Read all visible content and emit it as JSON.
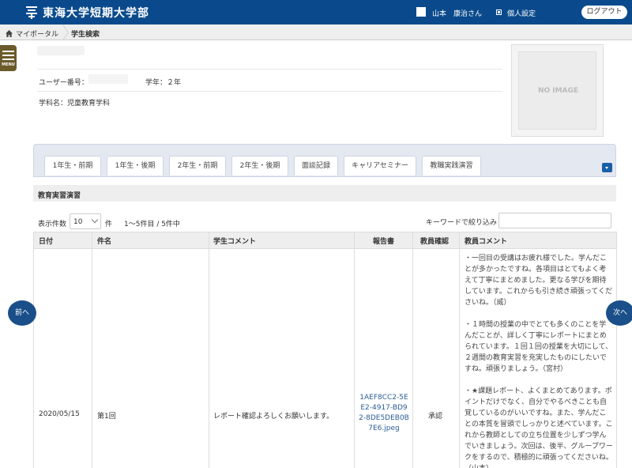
{
  "header": {
    "university": "東海大学短期大学部",
    "user_name": "山本　康治さん",
    "settings_label": "個人設定",
    "logout_label": "ログアウト"
  },
  "breadcrumb": {
    "home": "マイポータル",
    "current": "学生検索"
  },
  "menu_label": "MENU",
  "profile": {
    "user_no_label": "ユーザー番号：",
    "grade_label": "学年：２年",
    "dept_label": "学科名：児童教育学科",
    "no_image": "NO IMAGE"
  },
  "tabs": [
    {
      "label": "1年生・前期"
    },
    {
      "label": "1年生・後期"
    },
    {
      "label": "2年生・前期"
    },
    {
      "label": "2年生・後期"
    },
    {
      "label": "面談記録"
    },
    {
      "label": "キャリアセミナー"
    },
    {
      "label": "教職実践演習"
    }
  ],
  "section_title": "教育実習演習",
  "list": {
    "count_label": "表示件数",
    "count_value": "10",
    "count_unit": "件",
    "range": "1～5件目 / 5件中",
    "keyword_label": "キーワードで絞り込み"
  },
  "table": {
    "headers": [
      "日付",
      "件名",
      "学生コメント",
      "報告書",
      "教員確認",
      "教員コメント"
    ],
    "row": {
      "date": "2020/05/15",
      "subject": "第1回",
      "student_comment": "レポート確認よろしくお願いします。",
      "report": "1AEF8CC2-5EE2-4917-BD92-8DE5DEB0B7E6.jpeg",
      "confirm": "承認",
      "teacher_comments": [
        "・一回目の受講はお疲れ様でした。学んだことが多かったですね。各項目はとてもよく考えて丁寧にまとめました。更なる学びを期待しています。これからも引き続き頑張ってくださいね。（威）",
        "・１時間の授業の中でとても多くのことを学んだことが、詳しく丁寧にレポートにまとめられています。１回１回の授業を大切にして、２週間の教育実習を充実したものにしたいですね。頑張りましょう。（宮村）",
        "・★課題レポート、よくまとめてあります。ポイントだけでなく、自分でやるべきことも自覚しているのがいいですね。また、学んだことの本質を冒頭でしっかりと述べています。これから教師としての立ち位置を少しずつ学んでいきましょう。次回は、後半、グループワークをするので、積極的に頑張ってくださいね。（山本）"
      ]
    }
  },
  "nav": {
    "prev": "前へ",
    "next": "次へ"
  }
}
